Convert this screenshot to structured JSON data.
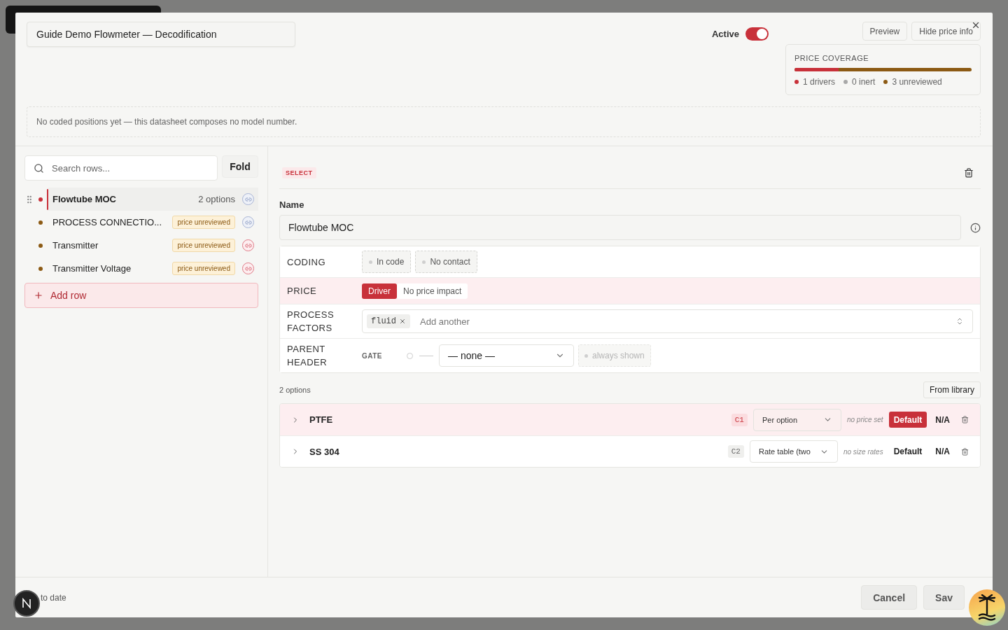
{
  "title_field": {
    "value": "Guide Demo Flowmeter — Decodification"
  },
  "active": {
    "label": "Active",
    "on": true
  },
  "header_buttons": [
    "Preview",
    "Hide price info"
  ],
  "price_coverage": {
    "title": "PRICE COVERAGE",
    "level": 0.25,
    "legend": [
      {
        "label": "1 drivers",
        "color": "#c8313a"
      },
      {
        "label": "0 inert",
        "color": "#a8a8a8"
      },
      {
        "label": "3 unreviewed",
        "color": "#8c5a14"
      }
    ]
  },
  "notice": "No coded positions yet — this datasheet composes no model number.",
  "search": {
    "placeholder": "Search rows..."
  },
  "fold_button": "Fold",
  "rows": [
    {
      "name": "Flowtube MOC",
      "meta": "2 options",
      "selected": true,
      "color": "#c8313a",
      "link_warning": false
    },
    {
      "name": "PROCESS CONNECTIO...",
      "badge": "price unreviewed",
      "selected": false,
      "color": "#8c5a14",
      "link_warning": false
    },
    {
      "name": "Transmitter",
      "badge": "price unreviewed",
      "selected": false,
      "color": "#8c5a14",
      "link_warning": true
    },
    {
      "name": "Transmitter Voltage",
      "badge": "price unreviewed",
      "selected": false,
      "color": "#8c5a14",
      "link_warning": true
    }
  ],
  "add_row": "Add row",
  "type_tag": "SELECT",
  "name_field": {
    "label": "Name",
    "value": "Flowtube MOC"
  },
  "properties": [
    {
      "kind": "chips",
      "label": "CODING",
      "chips": [
        "In code",
        "No contact"
      ]
    },
    {
      "kind": "segmented",
      "label": "PRICE",
      "options": [
        {
          "label": "Driver",
          "selected": true
        },
        {
          "label": "No price impact",
          "selected": false
        }
      ]
    },
    {
      "kind": "tags",
      "label": "PROCESS FACTORS",
      "tags": [
        "fluid"
      ],
      "placeholder": "Add another"
    },
    {
      "kind": "gate",
      "label": "PARENT HEADER",
      "gate_label": "GATE",
      "select": "— none —",
      "status": "always shown"
    }
  ],
  "options_count": "2 options",
  "from_library": "From library",
  "options": [
    {
      "name": "PTFE",
      "code": "C1",
      "pricing": "Per option",
      "note": "no price set",
      "default_label": "Default",
      "is_default": true,
      "value": "N/A",
      "selected": true
    },
    {
      "name": "SS 304",
      "code": "C2",
      "pricing": "Rate table (two",
      "note": "no size rates",
      "default_label": "Default",
      "is_default": false,
      "value": "N/A",
      "selected": false
    }
  ],
  "footer": {
    "status": "to date",
    "buttons": [
      "Cancel",
      "Sav"
    ]
  }
}
